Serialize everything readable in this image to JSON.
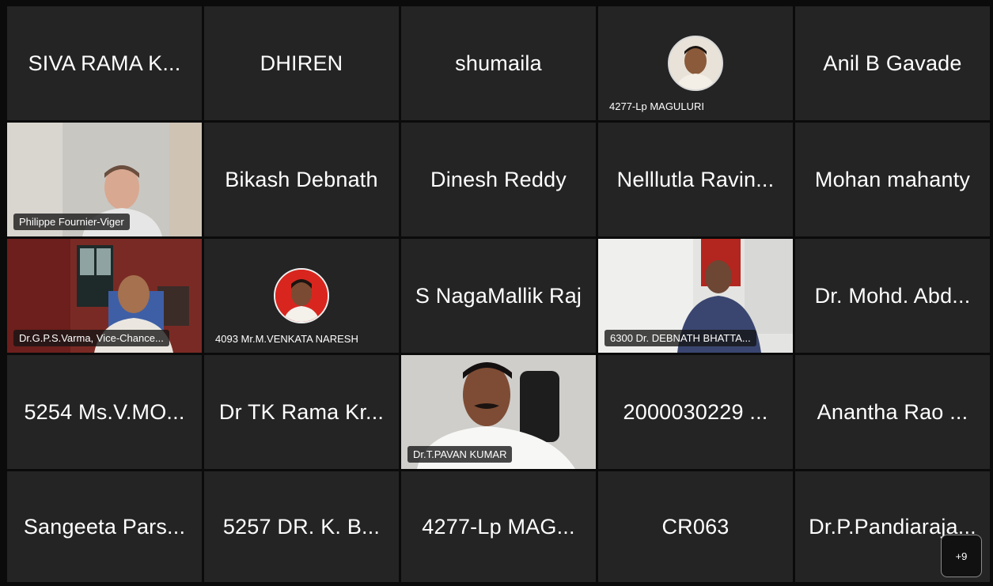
{
  "tiles": [
    {
      "name": "SIVA RAMA K..."
    },
    {
      "name": "DHIREN"
    },
    {
      "name": "shumaila"
    },
    {
      "label": "4277-Lp MAGULURI"
    },
    {
      "name": "Anil B Gavade"
    },
    {
      "label": "Philippe Fournier-Viger"
    },
    {
      "name": "Bikash Debnath"
    },
    {
      "name": "Dinesh Reddy"
    },
    {
      "name": "Nelllutla Ravin..."
    },
    {
      "name": "Mohan mahanty"
    },
    {
      "label": "Dr.G.P.S.Varma, Vice-Chance..."
    },
    {
      "label": "4093 Mr.M.VENKATA NARESH"
    },
    {
      "name": "S NagaMallik Raj"
    },
    {
      "label": "6300  Dr. DEBNATH BHATTA..."
    },
    {
      "name": "Dr. Mohd. Abd..."
    },
    {
      "name": "5254 Ms.V.MO..."
    },
    {
      "name": "Dr TK Rama Kr..."
    },
    {
      "label": "Dr.T.PAVAN KUMAR"
    },
    {
      "name": "2000030229 ..."
    },
    {
      "name": "Anantha Rao ..."
    },
    {
      "name": "Sangeeta Pars..."
    },
    {
      "name": "5257 DR. K. B..."
    },
    {
      "name": "4277-Lp MAG..."
    },
    {
      "name": "CR063"
    },
    {
      "name": "Dr.P.Pandiaraja..."
    }
  ],
  "more_participants": "+9"
}
